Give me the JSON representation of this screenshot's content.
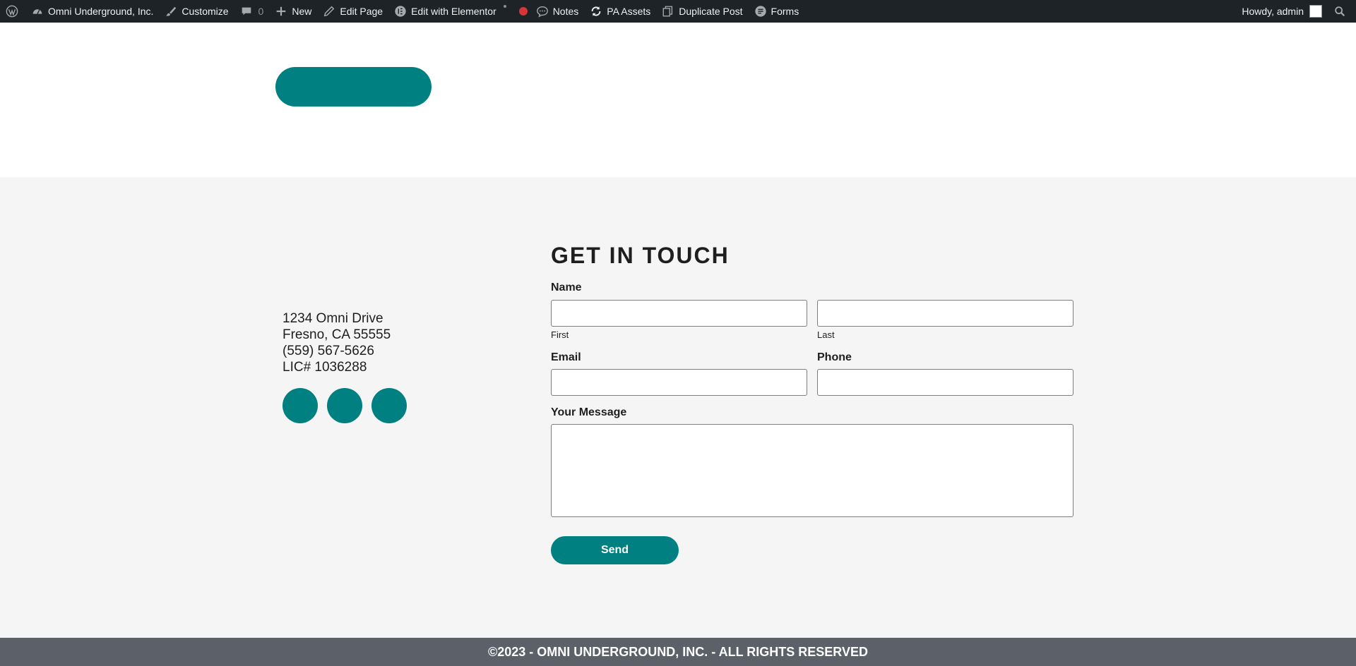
{
  "adminbar": {
    "site_name": "Omni Underground, Inc.",
    "customize": "Customize",
    "comments_count": "0",
    "new": "New",
    "edit_page": "Edit Page",
    "edit_elementor": "Edit with Elementor",
    "notes": "Notes",
    "pa_assets": "PA Assets",
    "duplicate_post": "Duplicate Post",
    "forms": "Forms",
    "howdy": "Howdy, admin"
  },
  "contact": {
    "address_lines": [
      "1234 Omni Drive",
      "Fresno, CA 55555",
      "(559) 567-5626",
      "LIC# 1036288"
    ],
    "heading": "GET IN TOUCH",
    "name_label": "Name",
    "first_label": "First",
    "last_label": "Last",
    "email_label": "Email",
    "phone_label": "Phone",
    "message_label": "Your Message",
    "send_label": "Send"
  },
  "footer": {
    "text": "©2023 - OMNI UNDERGROUND, INC. - ALL RIGHTS RESERVED"
  },
  "colors": {
    "accent": "#008080",
    "adminbar_bg": "#1d2327",
    "footer_bg": "#5b6069",
    "section_bg": "#f5f5f5"
  },
  "icons": [
    "wordpress-icon",
    "dashboard-icon",
    "brush-icon",
    "comment-icon",
    "plus-icon",
    "pencil-icon",
    "elementor-icon",
    "notes-icon",
    "sync-icon",
    "duplicate-icon",
    "forms-icon",
    "search-icon"
  ]
}
